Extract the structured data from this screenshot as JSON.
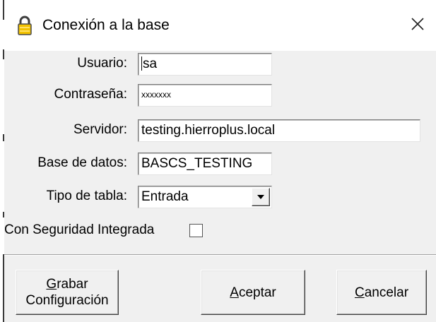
{
  "window": {
    "title": "Conexión a la base",
    "icon": "lock-icon",
    "close_icon": "close-icon"
  },
  "form": {
    "usuario": {
      "label": "Usuario:",
      "value": "sa"
    },
    "contrasena": {
      "label": "Contraseña:",
      "value": "xxxxxxx"
    },
    "servidor": {
      "label": "Servidor:",
      "value": "testing.hierroplus.local"
    },
    "base_datos": {
      "label": "Base de datos:",
      "value": "BASCS_TESTING"
    },
    "tipo_tabla": {
      "label": "Tipo de tabla:",
      "value": "Entrada",
      "dropdown_icon": "chevron-down-icon"
    },
    "seguridad": {
      "label": "Con Seguridad Integrada",
      "checked": false
    }
  },
  "buttons": {
    "grabar": {
      "line1_mnemonic": "G",
      "line1_rest": "rabar",
      "line2": "Configuración"
    },
    "aceptar": {
      "mnemonic": "A",
      "rest": "ceptar"
    },
    "cancelar": {
      "mnemonic": "C",
      "rest": "ancelar"
    }
  }
}
